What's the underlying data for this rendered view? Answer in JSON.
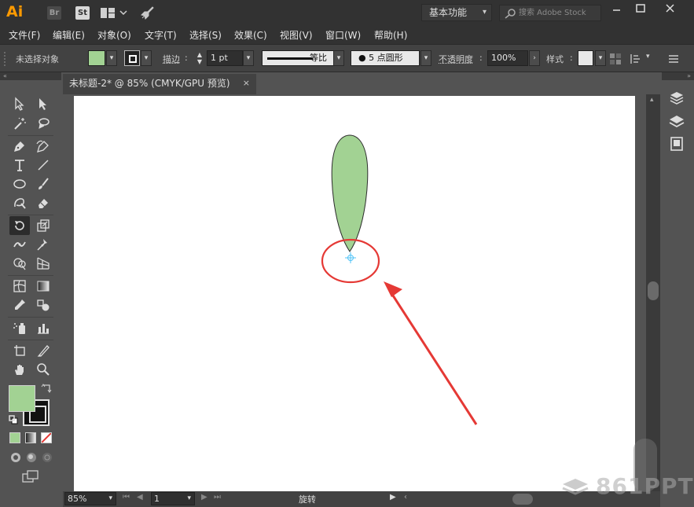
{
  "titlebar": {
    "logo": "Ai",
    "br_label": "Br",
    "st_label": "St",
    "workspace": "基本功能",
    "search_placeholder": "搜索 Adobe Stock"
  },
  "menu": [
    "文件(F)",
    "编辑(E)",
    "对象(O)",
    "文字(T)",
    "选择(S)",
    "效果(C)",
    "视图(V)",
    "窗口(W)",
    "帮助(H)"
  ],
  "control": {
    "selection": "未选择对象",
    "stroke_label": "描边",
    "stroke_weight": "1 pt",
    "line_profile": "等比",
    "brush": "5 点圆形",
    "opacity_label": "不透明度",
    "opacity_value": "100%",
    "style_label": "样式",
    "fill_color": "#a2d293"
  },
  "document": {
    "tab_title": "未标题-2* @ 85% (CMYK/GPU 预览)",
    "close": "×"
  },
  "status": {
    "zoom": "85%",
    "page": "1",
    "tool_name": "旋转"
  },
  "colors": {
    "shape_fill": "#a2d293",
    "annotation": "#e53935",
    "anchor": "#4fc3f7"
  },
  "watermark": "861PPT"
}
